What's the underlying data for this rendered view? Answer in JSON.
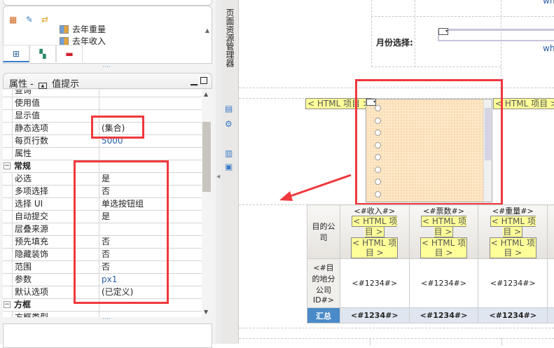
{
  "toolbar": {
    "icons": [
      "grid-icon",
      "edit-icon",
      "link-icon"
    ]
  },
  "tree": {
    "items": [
      {
        "label": "去年重量",
        "icon": "data-item-icon"
      },
      {
        "label": "去年收入",
        "icon": "data-item-icon"
      }
    ]
  },
  "tabs": [
    {
      "icon": "tree-icon"
    },
    {
      "icon": "blocks-icon"
    },
    {
      "icon": "toolbox-icon"
    }
  ],
  "properties": {
    "title": "属性 -",
    "subtitle": "值提示",
    "rows": [
      {
        "key": "查询",
        "value": ""
      },
      {
        "key": "使用值",
        "value": ""
      },
      {
        "key": "显示值",
        "value": ""
      },
      {
        "key": "静态选项",
        "value": "(集合)"
      },
      {
        "key": "每页行数",
        "value": "5000"
      },
      {
        "key": "属性",
        "value": ""
      },
      {
        "key": "常规",
        "value": "",
        "category": true
      },
      {
        "key": "必选",
        "value": "是"
      },
      {
        "key": "多项选择",
        "value": "否"
      },
      {
        "key": "选择 UI",
        "value": "单选按钮组"
      },
      {
        "key": "自动提交",
        "value": "是"
      },
      {
        "key": "层叠来源",
        "value": ""
      },
      {
        "key": "预先填充",
        "value": "否"
      },
      {
        "key": "隐藏装饰",
        "value": "否"
      },
      {
        "key": "范围",
        "value": "否"
      },
      {
        "key": "参数",
        "value": "px1"
      },
      {
        "key": "默认选项",
        "value": "(已定义)"
      },
      {
        "key": "方框",
        "value": "",
        "category": true
      },
      {
        "key": "方框类型",
        "value": ""
      }
    ]
  },
  "side_tab": {
    "label": "页面资源管理器"
  },
  "canvas": {
    "month_label": "月份选择:",
    "wh_top": "wh",
    "wh_mid": "wh",
    "html_item": "< HTML 项目 >",
    "html_item_a": "< HTML 项",
    "html_item_b": "目 >",
    "table": {
      "corner": "目的公司",
      "headers": [
        "<#收入#>",
        "<#票数#>",
        "<#重量#>"
      ],
      "row_label": "<#目的地分公司ID#>",
      "cell": "<#1234#>",
      "total_label": "汇总"
    }
  }
}
